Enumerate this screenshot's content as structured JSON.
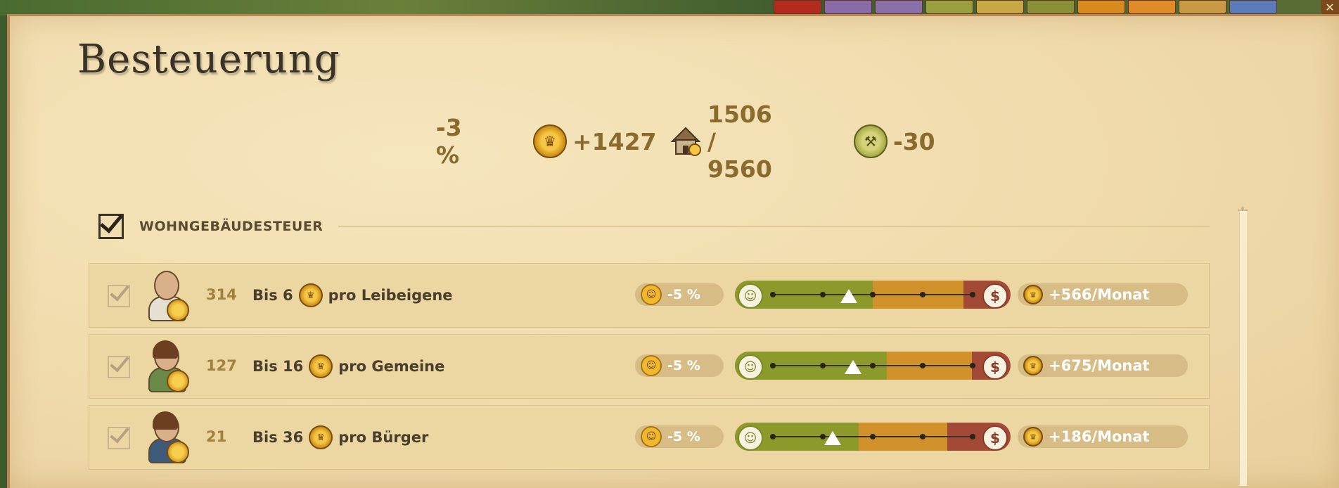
{
  "window": {
    "title": "Besteuerung",
    "close_icon": "close-icon"
  },
  "summary": {
    "tax_rate": "-3 %",
    "gold_income": "+1427",
    "housing": "1506 / 9560",
    "happiness": "-30"
  },
  "section": {
    "label": "WOHNGEBÄUDESTEUER",
    "checked": true
  },
  "rows": [
    {
      "count": "314",
      "prefix": "Bis 6",
      "suffix": "pro Leibeigene",
      "mood": "-5 %",
      "income": "+566/Monat",
      "slider_level": 0.38,
      "slider_green_end": 0.5,
      "slider_orange_end": 0.83,
      "avatar": "peasant-avatar",
      "body_color": "#e6e0d2",
      "hair": false
    },
    {
      "count": "127",
      "prefix": "Bis 16",
      "suffix": "pro Gemeine",
      "mood": "-5 %",
      "income": "+675/Monat",
      "slider_level": 0.4,
      "slider_green_end": 0.55,
      "slider_orange_end": 0.86,
      "avatar": "commoner-avatar",
      "body_color": "#6a8a4a",
      "hair": true
    },
    {
      "count": "21",
      "prefix": "Bis 36",
      "suffix": "pro Bürger",
      "mood": "-5 %",
      "income": "+186/Monat",
      "slider_level": 0.3,
      "slider_green_end": 0.45,
      "slider_orange_end": 0.77,
      "avatar": "citizen-avatar",
      "body_color": "#3e5a7a",
      "hair": true
    }
  ],
  "colors": {
    "parchment": "#f1deb0",
    "green_zone": "#8b9a2a",
    "orange_zone": "#d1922c",
    "red_zone": "#a24a35",
    "gold_text": "#8b6a2e"
  }
}
